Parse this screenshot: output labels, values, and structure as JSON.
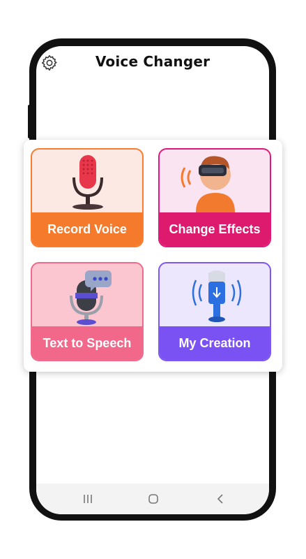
{
  "header": {
    "title": "Voice Changer",
    "settings_icon": "gear-icon"
  },
  "tiles": [
    {
      "label": "Record Voice",
      "icon": "microphone-icon",
      "color": "#f57a2c"
    },
    {
      "label": "Change Effects",
      "icon": "vr-headset-person-icon",
      "color": "#dd1a6d"
    },
    {
      "label": "Text to Speech",
      "icon": "microphone-chat-bubble-icon",
      "color": "#f2688a"
    },
    {
      "label": "My Creation",
      "icon": "blue-microphone-icon",
      "color": "#7a52f3"
    }
  ],
  "nav": {
    "recents": "recents-icon",
    "home": "home-icon",
    "back": "back-icon"
  }
}
